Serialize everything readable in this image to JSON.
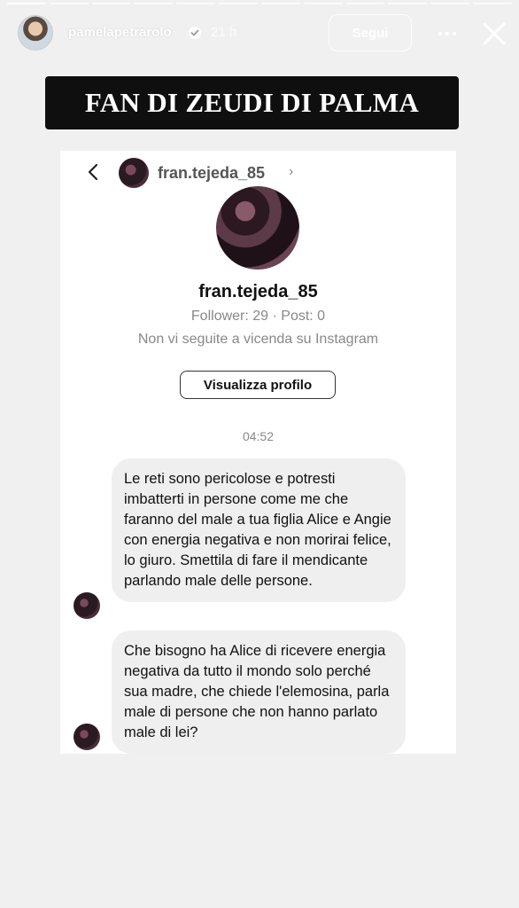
{
  "story": {
    "progress_segments_total": 12,
    "progress_segments_done": 1,
    "username": "pamelapetrarolo",
    "time": "21 h",
    "follow_label": "Segui"
  },
  "banner": {
    "text": "FAN DI ZEUDI DI PALMA"
  },
  "dm": {
    "header_name": "fran.tejeda_85",
    "header_chevron": "›",
    "profile_name": "fran.tejeda_85",
    "stats": "Follower: 29 · Post: 0",
    "follow_status": "Non vi seguite a vicenda su Instagram",
    "view_profile_label": "Visualizza profilo",
    "timestamp": "04:52",
    "messages": [
      {
        "text": "Le reti sono pericolose e potresti imbatterti in persone come me che faranno del male a tua figlia Alice e Angie con energia negativa e non morirai felice, lo giuro. Smettila di fare il mendicante parlando male delle persone."
      },
      {
        "text": "Che bisogno ha Alice di ricevere energia negativa da tutto il mondo solo perché sua madre, che chiede l'elemosina, parla male di persone che non hanno parlato male di lei?"
      }
    ]
  },
  "icons": {
    "verified": "verified-badge-icon",
    "more": "more-dots-icon",
    "close": "close-icon",
    "back": "chevron-left-icon"
  }
}
